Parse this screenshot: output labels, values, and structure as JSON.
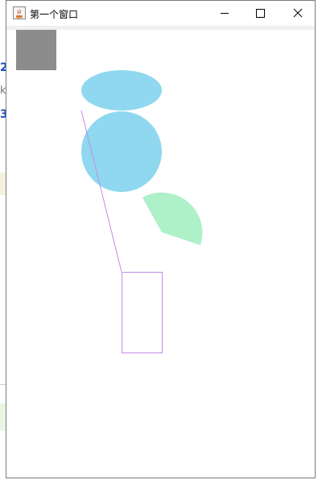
{
  "window": {
    "title": "第一个窗口",
    "controls": {
      "minimize": "minimize-icon",
      "maximize": "maximize-icon",
      "close": "close-icon"
    },
    "app_icon": "java-coffee-icon"
  },
  "background": {
    "fragments": [
      "2",
      "k",
      "3"
    ]
  },
  "canvas": {
    "colors": {
      "gray_square": "#8c8c8c",
      "cyan_shapes": "#8fd8ef",
      "green_arc": "#aef0c8",
      "purple_lines": "#c48be6"
    }
  }
}
